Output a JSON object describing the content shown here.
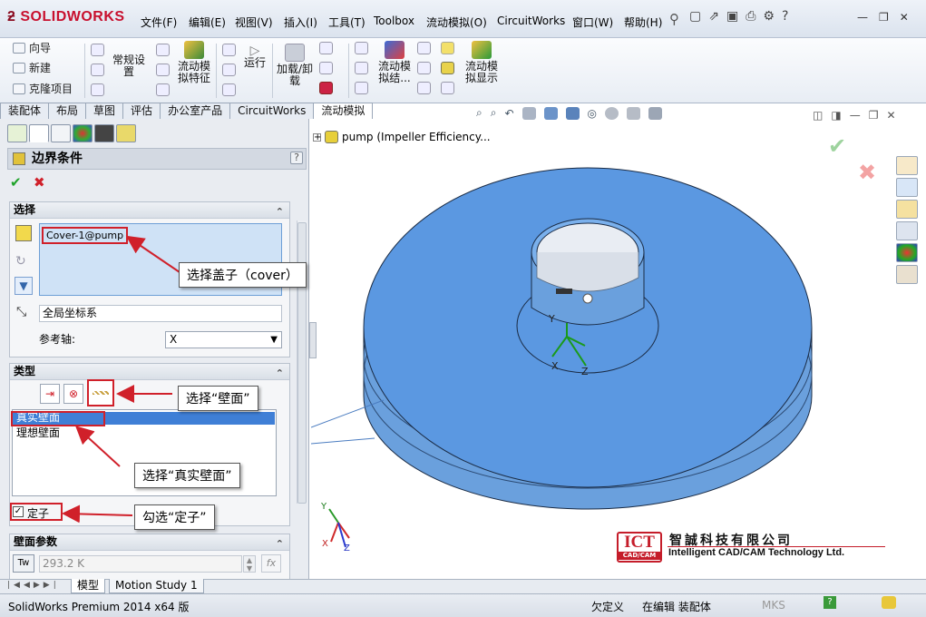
{
  "app": {
    "logo_main": "SOLIDWORKS"
  },
  "menu": [
    "文件(F)",
    "编辑(E)",
    "视图(V)",
    "插入(I)",
    "工具(T)",
    "Toolbox",
    "流动模拟(O)",
    "CircuitWorks",
    "窗口(W)",
    "帮助(H)"
  ],
  "ribbon": {
    "wizard": "向导",
    "new": "新建",
    "clone": "克隆项目",
    "general_settings": "常规设置",
    "flow_features": "流动模拟特征",
    "run": "运行",
    "load_unload": "加载/卸载",
    "flow_results": "流动模拟结...",
    "flow_display": "流动模拟显示"
  },
  "cmd_tabs": [
    "装配体",
    "布局",
    "草图",
    "评估",
    "办公室产品",
    "CircuitWorks",
    "流动模拟"
  ],
  "active_tab": "流动模拟",
  "tree": {
    "root": "pump  (Impeller Efficiency..."
  },
  "property_manager": {
    "title": "边界条件",
    "help": "?",
    "ok": "✔",
    "cancel": "✖",
    "selection": {
      "header": "选择",
      "item": "Cover-1@pump",
      "coord_system": "全局坐标系",
      "ref_axis_label": "参考轴:",
      "ref_axis_value": "X"
    },
    "type": {
      "header": "类型",
      "options": [
        "真实壁面",
        "理想壁面"
      ],
      "selected": "真实壁面",
      "stator_label": "定子",
      "stator_checked": true
    },
    "wall_params": {
      "header": "壁面参数",
      "temperature": "293.2 K",
      "tw_label": "Tw",
      "fx_label": "fx"
    }
  },
  "callouts": {
    "cover": "选择盖子（cover）",
    "wall": "选择“壁面”",
    "real_wall": "选择“真实壁面”",
    "stator": "勾选“定子”"
  },
  "bottom_tabs": [
    "模型",
    "Motion Study 1"
  ],
  "status": {
    "product": "SolidWorks Premium 2014 x64 版",
    "under_defined": "欠定义",
    "editing": "在编辑 装配体",
    "units": "MKS"
  },
  "watermark": {
    "logo_text": "ICT",
    "logo_sub": "CAD/CAM",
    "company_cn": "智誠科技有限公司",
    "company_en": "Intelligent CAD/CAM Technology Ltd."
  },
  "triad": {
    "x": "X",
    "y": "Y",
    "z": "Z"
  }
}
